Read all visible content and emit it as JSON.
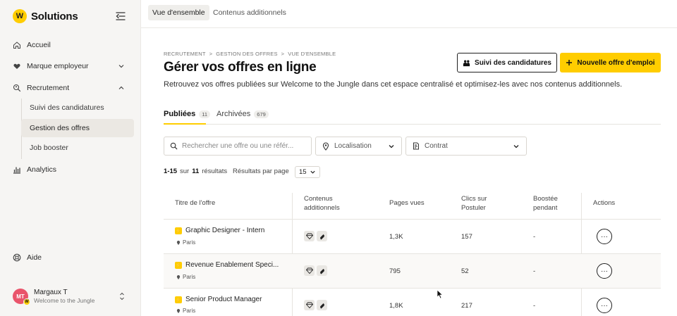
{
  "sidebar": {
    "brand": {
      "logo": "W",
      "name": "Solutions"
    },
    "nav": {
      "home": "Accueil",
      "employer": "Marque employeur",
      "recruitment": "Recrutement",
      "analytics": "Analytics",
      "help": "Aide"
    },
    "sub": [
      "Suivi des candidatures",
      "Gestion des offres",
      "Job booster"
    ],
    "user": {
      "initials": "MT",
      "badge": "W",
      "name": "Margaux T",
      "company": "Welcome to the Jungle"
    }
  },
  "top_tabs": [
    "Vue d'ensemble",
    "Contenus additionnels"
  ],
  "breadcrumb": [
    "RECRUTEMENT",
    ">",
    "GESTION DES OFFRES",
    ">",
    "VUE D'ENSEMBLE"
  ],
  "page": {
    "title": "Gérer vos offres en ligne",
    "description": "Retrouvez vos offres publiées sur Welcome to the Jungle dans cet espace centralisé et optimisez-les avec nos contenus additionnels."
  },
  "buttons": {
    "applications": "Suivi des candidatures",
    "new_offer": "Nouvelle offre d'emploi"
  },
  "tabs": {
    "published": {
      "label": "Publiées",
      "count": "11"
    },
    "archived": {
      "label": "Archivées",
      "count": "679"
    }
  },
  "filters": {
    "search_placeholder": "Rechercher une offre ou une référ...",
    "location": "Localisation",
    "contract": "Contrat"
  },
  "results": {
    "range": "1-15",
    "sur": "sur",
    "total": "11",
    "label": "résultats",
    "per_page_label": "Résultats par page",
    "per_page": "15"
  },
  "table": {
    "headers": {
      "title": "Titre de l'offre",
      "contents_1": "Contenus",
      "contents_2": "additionnels",
      "views": "Pages vues",
      "clicks_1": "Clics sur",
      "clicks_2": "Postuler",
      "boosted_1": "Boostée",
      "boosted_2": "pendant",
      "actions": "Actions"
    },
    "rows": [
      {
        "title": "Graphic Designer - Intern",
        "location": "Paris",
        "views": "1,3K",
        "clicks": "157",
        "boosted": "-",
        "action": "···"
      },
      {
        "title": "Revenue Enablement Speci...",
        "location": "Paris",
        "views": "795",
        "clicks": "52",
        "boosted": "-",
        "action": "···"
      },
      {
        "title": "Senior Product Manager",
        "location": "Paris",
        "views": "1,8K",
        "clicks": "217",
        "boosted": "-",
        "action": "···"
      }
    ]
  },
  "colors": {
    "accent": "#ffcd00",
    "sidebar_bg": "#f6f5f3",
    "avatar": "#e9546b"
  }
}
